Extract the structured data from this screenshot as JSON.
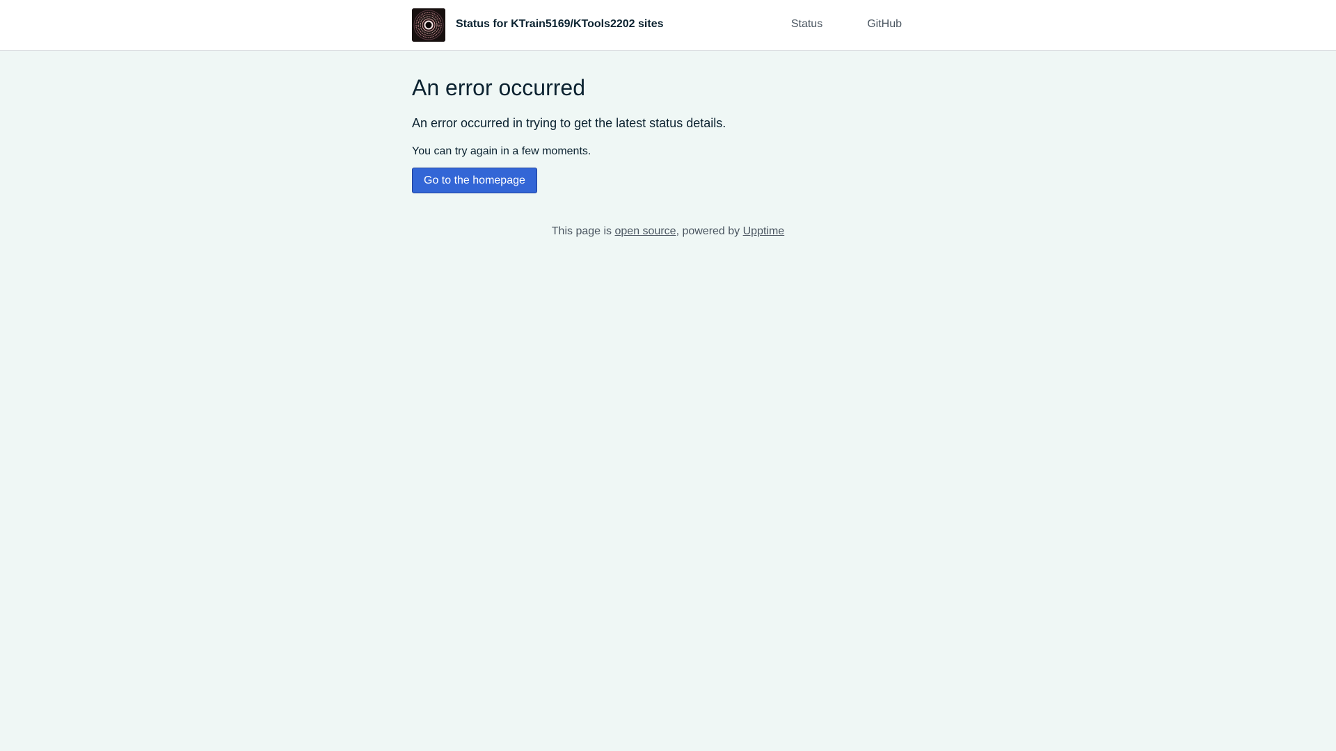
{
  "header": {
    "site_title": "Status for KTrain5169/KTools2202 sites",
    "logo_icon": "concentric-rings-logo-icon",
    "nav": [
      {
        "label": "Status"
      },
      {
        "label": "GitHub"
      }
    ]
  },
  "main": {
    "title": "An error occurred",
    "lead": "An error occurred in trying to get the latest status details.",
    "note": "You can try again in a few moments.",
    "button_label": "Go to the homepage"
  },
  "footer": {
    "prefix": "This page is ",
    "link1": "open source",
    "middle": ", powered by ",
    "link2": "Upptime"
  },
  "colors": {
    "background": "#eff7f5",
    "header_background": "#ffffff",
    "button": "#3366d6",
    "text": "#0b2230",
    "muted": "#4a5560"
  }
}
